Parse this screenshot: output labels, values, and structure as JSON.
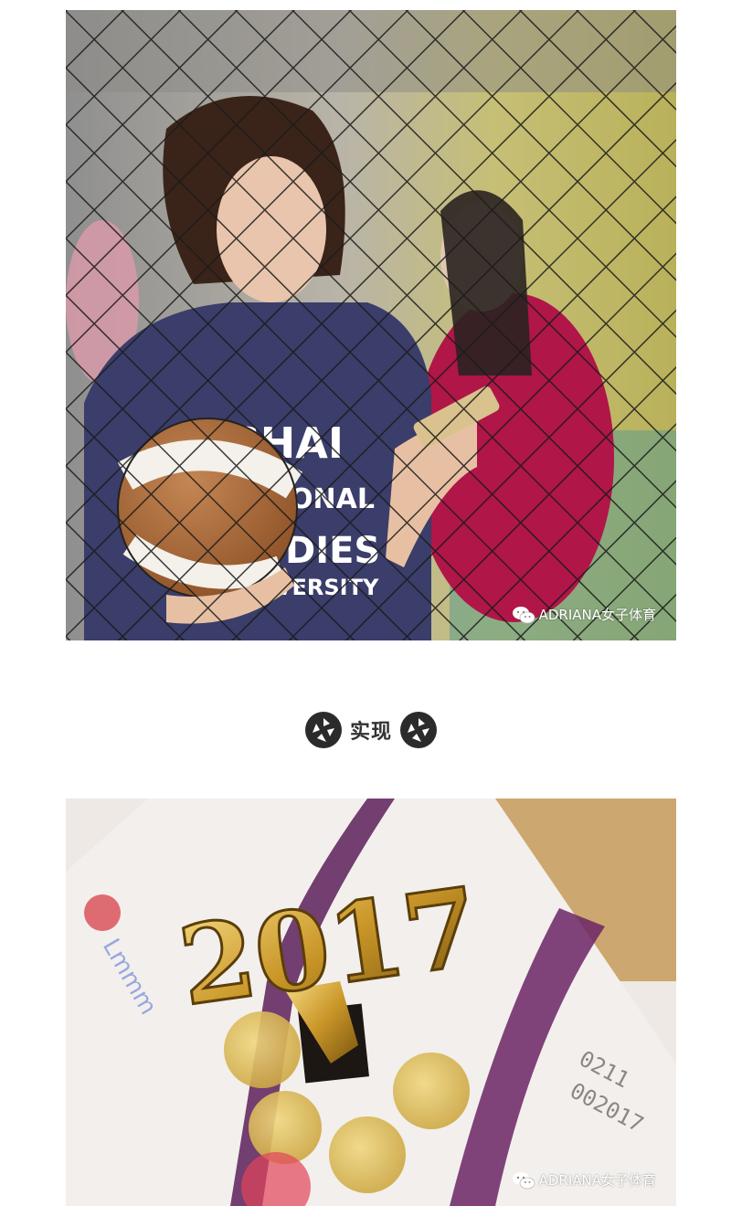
{
  "photos": [
    {
      "watermark": "ADRIANA女子体育"
    },
    {
      "watermark": "ADRIANA女子体育"
    }
  ],
  "section": {
    "heading": "实现"
  },
  "icons": {
    "heading_icon": "aperture-icon",
    "watermark_icon": "wechat-icon"
  },
  "colors": {
    "heading_text": "#333333",
    "icon_fill": "#2b2b2b"
  }
}
